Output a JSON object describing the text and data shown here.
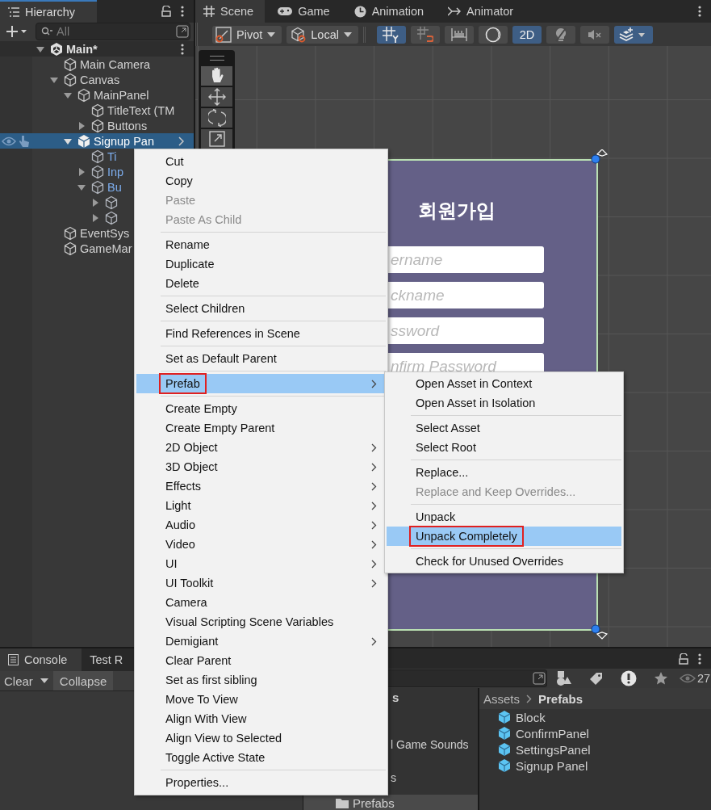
{
  "hierarchy": {
    "title": "Hierarchy",
    "search": {
      "placeholder": "All"
    },
    "tree": [
      {
        "label": "Main*",
        "kind": "scene",
        "expanded": true,
        "selected": false,
        "children": [
          {
            "label": "Main Camera",
            "kind": "object",
            "selected": false
          },
          {
            "label": "Canvas",
            "kind": "object",
            "expanded": true,
            "selected": false,
            "children": [
              {
                "label": "MainPanel",
                "kind": "object",
                "expanded": true,
                "selected": false,
                "children": [
                  {
                    "label": "TitleText (TM",
                    "kind": "object",
                    "selected": false
                  },
                  {
                    "label": "Buttons",
                    "kind": "object",
                    "expanded": false,
                    "selected": false
                  }
                ]
              },
              {
                "label": "Signup Pan",
                "kind": "prefab_root",
                "expanded": true,
                "selected": true,
                "children": [
                  {
                    "label": "Ti",
                    "kind": "prefab_child",
                    "selected": false
                  },
                  {
                    "label": "Inp",
                    "kind": "prefab_child",
                    "expanded": false,
                    "selected": false
                  },
                  {
                    "label": "Bu",
                    "kind": "prefab_child",
                    "expanded": true,
                    "selected": false,
                    "children": [
                      {
                        "kind": "prefab_child",
                        "expanded": false,
                        "selected": false
                      },
                      {
                        "kind": "prefab_child",
                        "expanded": false,
                        "selected": false
                      }
                    ]
                  }
                ]
              }
            ]
          },
          {
            "label": "EventSys",
            "kind": "object",
            "selected": false
          },
          {
            "label": "GameMar",
            "kind": "object",
            "selected": false
          }
        ]
      }
    ]
  },
  "scene": {
    "tabs": [
      {
        "label": "Scene",
        "selected": true
      },
      {
        "label": "Game",
        "selected": false
      },
      {
        "label": "Animation",
        "selected": false
      },
      {
        "label": "Animator",
        "selected": false
      }
    ],
    "pivot": {
      "label": "Pivot"
    },
    "space": {
      "label": "Local"
    },
    "buttons": [
      {
        "on": true
      },
      {
        "on": false
      },
      {
        "on": false
      },
      {
        "on": false
      },
      {
        "label": "2D",
        "on": true
      },
      {
        "on": false
      },
      {
        "on": false
      },
      {
        "on": true
      }
    ],
    "tools": [
      {
        "selected": true
      },
      {
        "selected": false
      },
      {
        "selected": false
      },
      {
        "selected": false
      }
    ],
    "panel": {
      "title": "회원가입",
      "fields": [
        {
          "placeholder": "ername"
        },
        {
          "placeholder": "ckname"
        },
        {
          "placeholder": "ssword"
        },
        {
          "placeholder": "nfirm Password"
        }
      ]
    }
  },
  "context_menu": {
    "groups": [
      [
        {
          "label": "Cut",
          "disabled": false,
          "submenu": false,
          "selected": false
        },
        {
          "label": "Copy",
          "disabled": false,
          "submenu": false,
          "selected": false
        },
        {
          "label": "Paste",
          "disabled": true,
          "submenu": false,
          "selected": false
        },
        {
          "label": "Paste As Child",
          "disabled": true,
          "submenu": false,
          "selected": false
        }
      ],
      [
        {
          "label": "Rename",
          "disabled": false,
          "submenu": false,
          "selected": false
        },
        {
          "label": "Duplicate",
          "disabled": false,
          "submenu": false,
          "selected": false
        },
        {
          "label": "Delete",
          "disabled": false,
          "submenu": false,
          "selected": false
        }
      ],
      [
        {
          "label": "Select Children",
          "disabled": false,
          "submenu": false,
          "selected": false
        }
      ],
      [
        {
          "label": "Find References in Scene",
          "disabled": false,
          "submenu": false,
          "selected": false
        }
      ],
      [
        {
          "label": "Set as Default Parent",
          "disabled": false,
          "submenu": false,
          "selected": false
        }
      ],
      [
        {
          "label": "Prefab",
          "disabled": false,
          "submenu": true,
          "selected": true,
          "outlined": true
        }
      ],
      [
        {
          "label": "Create Empty",
          "disabled": false,
          "submenu": false,
          "selected": false
        },
        {
          "label": "Create Empty Parent",
          "disabled": false,
          "submenu": false,
          "selected": false
        },
        {
          "label": "2D Object",
          "disabled": false,
          "submenu": true,
          "selected": false
        },
        {
          "label": "3D Object",
          "disabled": false,
          "submenu": true,
          "selected": false
        },
        {
          "label": "Effects",
          "disabled": false,
          "submenu": true,
          "selected": false
        },
        {
          "label": "Light",
          "disabled": false,
          "submenu": true,
          "selected": false
        },
        {
          "label": "Audio",
          "disabled": false,
          "submenu": true,
          "selected": false
        },
        {
          "label": "Video",
          "disabled": false,
          "submenu": true,
          "selected": false
        },
        {
          "label": "UI",
          "disabled": false,
          "submenu": true,
          "selected": false
        },
        {
          "label": "UI Toolkit",
          "disabled": false,
          "submenu": true,
          "selected": false
        },
        {
          "label": "Camera",
          "disabled": false,
          "submenu": false,
          "selected": false
        },
        {
          "label": "Visual Scripting Scene Variables",
          "disabled": false,
          "submenu": false,
          "selected": false
        },
        {
          "label": "Demigiant",
          "disabled": false,
          "submenu": true,
          "selected": false
        },
        {
          "label": "Clear Parent",
          "disabled": false,
          "submenu": false,
          "selected": false
        },
        {
          "label": "Set as first sibling",
          "disabled": false,
          "submenu": false,
          "selected": false
        },
        {
          "label": "Move To View",
          "disabled": false,
          "submenu": false,
          "selected": false
        },
        {
          "label": "Align With View",
          "disabled": false,
          "submenu": false,
          "selected": false
        },
        {
          "label": "Align View to Selected",
          "disabled": false,
          "submenu": false,
          "selected": false
        },
        {
          "label": "Toggle Active State",
          "disabled": false,
          "submenu": false,
          "selected": false
        }
      ],
      [
        {
          "label": "Properties...",
          "disabled": false,
          "submenu": false,
          "selected": false
        }
      ]
    ]
  },
  "submenu": {
    "groups": [
      [
        {
          "label": "Open Asset in Context",
          "disabled": false,
          "selected": false
        },
        {
          "label": "Open Asset in Isolation",
          "disabled": false,
          "selected": false
        }
      ],
      [
        {
          "label": "Select Asset",
          "disabled": false,
          "selected": false
        },
        {
          "label": "Select Root",
          "disabled": false,
          "selected": false
        }
      ],
      [
        {
          "label": "Replace...",
          "disabled": false,
          "selected": false
        },
        {
          "label": "Replace and Keep Overrides...",
          "disabled": true,
          "selected": false
        }
      ],
      [
        {
          "label": "Unpack",
          "disabled": false,
          "selected": false
        },
        {
          "label": "Unpack Completely",
          "disabled": false,
          "selected": true,
          "outlined": true
        }
      ],
      [
        {
          "label": "Check for Unused Overrides",
          "disabled": false,
          "selected": false
        }
      ]
    ]
  },
  "console": {
    "tabs": [
      {
        "label": "Console",
        "selected": true
      },
      {
        "label": "Test R",
        "selected": false
      }
    ],
    "clear": {
      "label": "Clear"
    },
    "collapse": {
      "label": "Collapse",
      "on": false
    }
  },
  "project": {
    "count": "27",
    "tree": [
      {
        "label": "s",
        "kind": "header",
        "selected": false
      },
      {
        "label": "l Game Sounds",
        "kind": "cut",
        "selected": false
      },
      {
        "label": "s",
        "kind": "cut",
        "selected": false
      },
      {
        "label": "Prefabs",
        "kind": "folder",
        "selected": true
      }
    ],
    "breadcrumb": [
      {
        "label": "Assets",
        "current": false
      },
      {
        "label": "Prefabs",
        "current": true
      }
    ],
    "items": [
      {
        "label": "Block"
      },
      {
        "label": "ConfirmPanel"
      },
      {
        "label": "SettingsPanel"
      },
      {
        "label": "Signup Panel"
      }
    ]
  }
}
